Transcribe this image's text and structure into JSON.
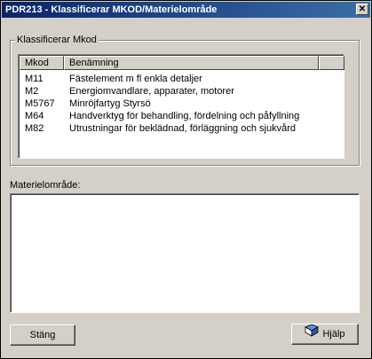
{
  "window": {
    "title": "PDR213 - Klassificerar MKOD/Materielområde"
  },
  "group": {
    "label": "Klassificerar Mkod"
  },
  "list": {
    "columns": [
      "Mkod",
      "Benämning"
    ],
    "rows": [
      {
        "code": "M11",
        "name": "Fästelement m fl enkla detaljer"
      },
      {
        "code": "M2",
        "name": "Energiomvandlare, apparater, motorer"
      },
      {
        "code": "M5767",
        "name": "Minröjfartyg Styrsö"
      },
      {
        "code": "M64",
        "name": "Handverktyg för behandling, fördelning och påfyllning"
      },
      {
        "code": "M82",
        "name": "Utrustningar för beklädnad, förläggning och sjukvård"
      }
    ]
  },
  "material": {
    "label": "Materielområde:",
    "value": ""
  },
  "buttons": {
    "close": "Stäng",
    "help": "Hjälp"
  },
  "icons": {
    "close": "close-icon",
    "help": "book-icon"
  }
}
